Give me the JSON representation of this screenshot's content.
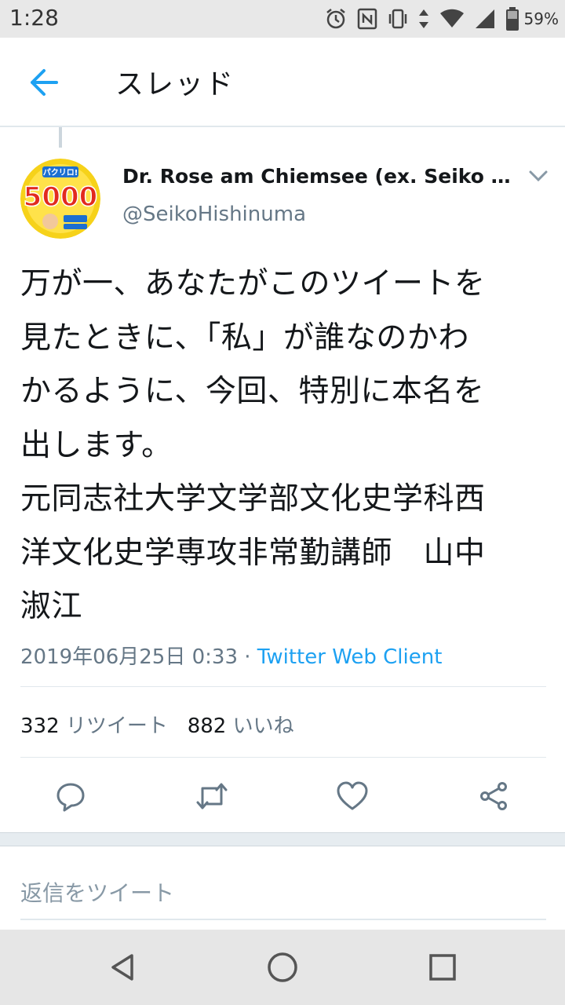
{
  "status_bar": {
    "time": "1:28",
    "battery": "59%",
    "icons": [
      "alarm-icon",
      "nfc-icon",
      "vibrate-icon",
      "data-arrows-icon",
      "wifi-icon",
      "signal-icon",
      "battery-icon"
    ]
  },
  "header": {
    "title": "スレッド",
    "back_icon": "arrow-left-icon",
    "accent_color": "#1da1f2"
  },
  "tweet": {
    "avatar_text": "5000",
    "avatar_banner": "パクリロ!",
    "display_name": "Dr. Rose am Chiemsee (ex. Seiko H...",
    "handle": "@SeikoHishinuma",
    "text": "万が一、あなたがこのツイートを\n見たときに、「私」が誰なのかわ\nかるように、今回、特別に本名を\n出します。\n元同志社大学文学部文化史学科西\n洋文化史学専攻非常勤講師　山中\n淑江",
    "timestamp": "2019年06月25日 0:33",
    "separator": " · ",
    "client": "Twitter Web Client",
    "retweet_count": "332",
    "retweet_label": "リツイート",
    "like_count": "882",
    "like_label": "いいね",
    "actions": [
      "reply-icon",
      "retweet-icon",
      "like-icon",
      "share-icon"
    ]
  },
  "reply": {
    "placeholder": "返信をツイート"
  },
  "nav": [
    "back-triangle-icon",
    "home-circle-icon",
    "recents-square-icon"
  ]
}
